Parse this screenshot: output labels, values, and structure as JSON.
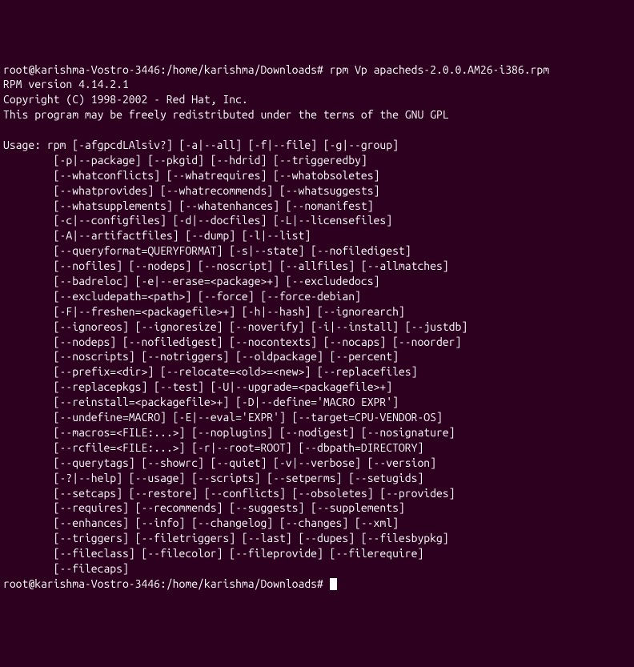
{
  "prompt1": {
    "user": "root@karishma-Vostro-3446",
    "path": "/home/karishma/Downloads",
    "command": "rpm Vp apacheds-2.0.0.AM26-i386.rpm"
  },
  "version": "RPM version 4.14.2.1",
  "copyright": "Copyright (C) 1998-2002 - Red Hat, Inc.",
  "gpl": "This program may be freely redistributed under the terms of the GNU GPL",
  "usage_header": "Usage: rpm [-afgpcdLAlsiv?] [-a|--all] [-f|--file] [-g|--group]",
  "usage_lines": [
    "        [-p|--package] [--pkgid] [--hdrid] [--triggeredby]",
    "        [--whatconflicts] [--whatrequires] [--whatobsoletes]",
    "        [--whatprovides] [--whatrecommends] [--whatsuggests]",
    "        [--whatsupplements] [--whatenhances] [--nomanifest]",
    "        [-c|--configfiles] [-d|--docfiles] [-L|--licensefiles]",
    "        [-A|--artifactfiles] [--dump] [-l|--list]",
    "        [--queryformat=QUERYFORMAT] [-s|--state] [--nofiledigest]",
    "        [--nofiles] [--nodeps] [--noscript] [--allfiles] [--allmatches]",
    "        [--badreloc] [-e|--erase=<package>+] [--excludedocs]",
    "        [--excludepath=<path>] [--force] [--force-debian]",
    "        [-F|--freshen=<packagefile>+] [-h|--hash] [--ignorearch]",
    "        [--ignoreos] [--ignoresize] [--noverify] [-i|--install] [--justdb]",
    "        [--nodeps] [--nofiledigest] [--nocontexts] [--nocaps] [--noorder]",
    "        [--noscripts] [--notriggers] [--oldpackage] [--percent]",
    "        [--prefix=<dir>] [--relocate=<old>=<new>] [--replacefiles]",
    "        [--replacepkgs] [--test] [-U|--upgrade=<packagefile>+]",
    "        [--reinstall=<packagefile>+] [-D|--define='MACRO EXPR']",
    "        [--undefine=MACRO] [-E|--eval='EXPR'] [--target=CPU-VENDOR-OS]",
    "        [--macros=<FILE:...>] [--noplugins] [--nodigest] [--nosignature]",
    "        [--rcfile=<FILE:...>] [-r|--root=ROOT] [--dbpath=DIRECTORY]",
    "        [--querytags] [--showrc] [--quiet] [-v|--verbose] [--version]",
    "        [-?|--help] [--usage] [--scripts] [--setperms] [--setugids]",
    "        [--setcaps] [--restore] [--conflicts] [--obsoletes] [--provides]",
    "        [--requires] [--recommends] [--suggests] [--supplements]",
    "        [--enhances] [--info] [--changelog] [--changes] [--xml]",
    "        [--triggers] [--filetriggers] [--last] [--dupes] [--filesbypkg]",
    "        [--fileclass] [--filecolor] [--fileprovide] [--filerequire]",
    "        [--filecaps]"
  ],
  "prompt2": {
    "user": "root@karishma-Vostro-3446",
    "path": "/home/karishma/Downloads"
  }
}
